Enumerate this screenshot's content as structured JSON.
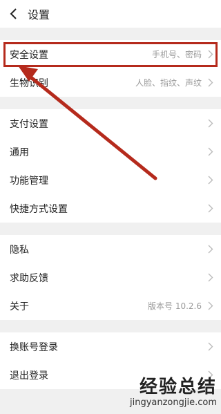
{
  "header": {
    "title": "设置",
    "back_icon": "chevron-left-icon"
  },
  "groups": [
    {
      "rows": [
        {
          "label": "安全设置",
          "value": "手机号、密码"
        },
        {
          "label": "生物识别",
          "value": "人脸、指纹、声纹"
        }
      ]
    },
    {
      "rows": [
        {
          "label": "支付设置",
          "value": ""
        },
        {
          "label": "通用",
          "value": ""
        },
        {
          "label": "功能管理",
          "value": ""
        },
        {
          "label": "快捷方式设置",
          "value": ""
        }
      ]
    },
    {
      "rows": [
        {
          "label": "隐私",
          "value": ""
        },
        {
          "label": "求助反馈",
          "value": ""
        },
        {
          "label": "关于",
          "value": "版本号 10.2.6"
        }
      ]
    },
    {
      "rows": [
        {
          "label": "换账号登录",
          "value": ""
        },
        {
          "label": "退出登录",
          "value": ""
        }
      ]
    }
  ],
  "watermark": {
    "title": "经验总结",
    "url": "jingyanzongjie.com"
  },
  "colors": {
    "annotation": "#b52a1c",
    "background": "#f0f0f0",
    "chevron": "#bbbbbb"
  }
}
